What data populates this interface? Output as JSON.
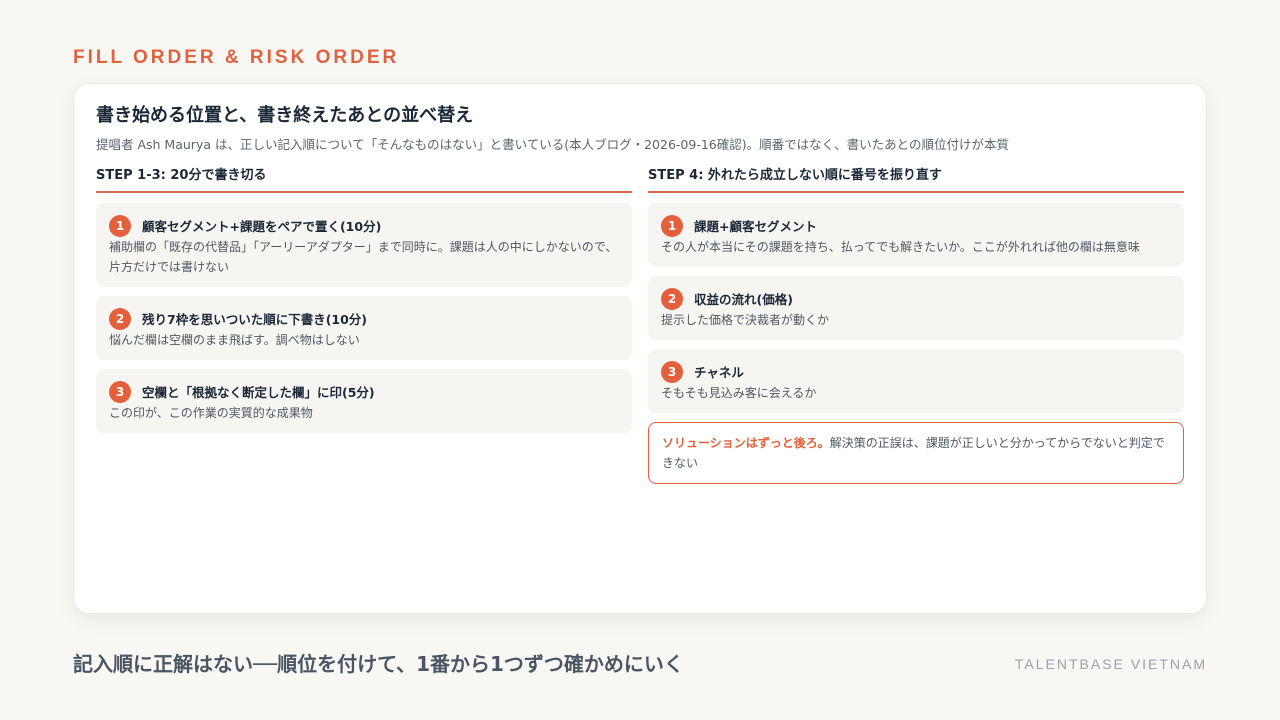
{
  "kicker": "FILL ORDER & RISK ORDER",
  "card": {
    "title": "書き始める位置と、書き終えたあとの並べ替え",
    "subtitle": "提唱者 Ash Maurya は、正しい記入順について「そんなものはない」と書いている(本人ブログ・2026-09-16確認)。順番ではなく、書いたあとの順位付けが本質"
  },
  "left": {
    "heading": "STEP 1-3: 20分で書き切る",
    "steps": [
      {
        "num": "1",
        "title": "顧客セグメント+課題をペアで置く(10分)",
        "desc": "補助欄の「既存の代替品」「アーリーアダプター」まで同時に。課題は人の中にしかないので、片方だけでは書けない"
      },
      {
        "num": "2",
        "title": "残り7枠を思いついた順に下書き(10分)",
        "desc": "悩んだ欄は空欄のまま飛ばす。調べ物はしない"
      },
      {
        "num": "3",
        "title": "空欄と「根拠なく断定した欄」に印(5分)",
        "desc": "この印が、この作業の実質的な成果物"
      }
    ]
  },
  "right": {
    "heading": "STEP 4: 外れたら成立しない順に番号を振り直す",
    "steps": [
      {
        "num": "1",
        "title": "課題+顧客セグメント",
        "desc": "その人が本当にその課題を持ち、払ってでも解きたいか。ここが外れれば他の欄は無意味"
      },
      {
        "num": "2",
        "title": "収益の流れ(価格)",
        "desc": "提示した価格で決裁者が動くか"
      },
      {
        "num": "3",
        "title": "チャネル",
        "desc": "そもそも見込み客に会えるか"
      }
    ],
    "callout": {
      "strong": "ソリューションはずっと後ろ。",
      "text": "解決策の正誤は、課題が正しいと分かってからでないと判定できない"
    }
  },
  "footer": {
    "main": "記入順に正解はない──順位を付けて、1番から1つずつ確かめにいく",
    "brand": "TALENTBASE VIETNAM"
  }
}
